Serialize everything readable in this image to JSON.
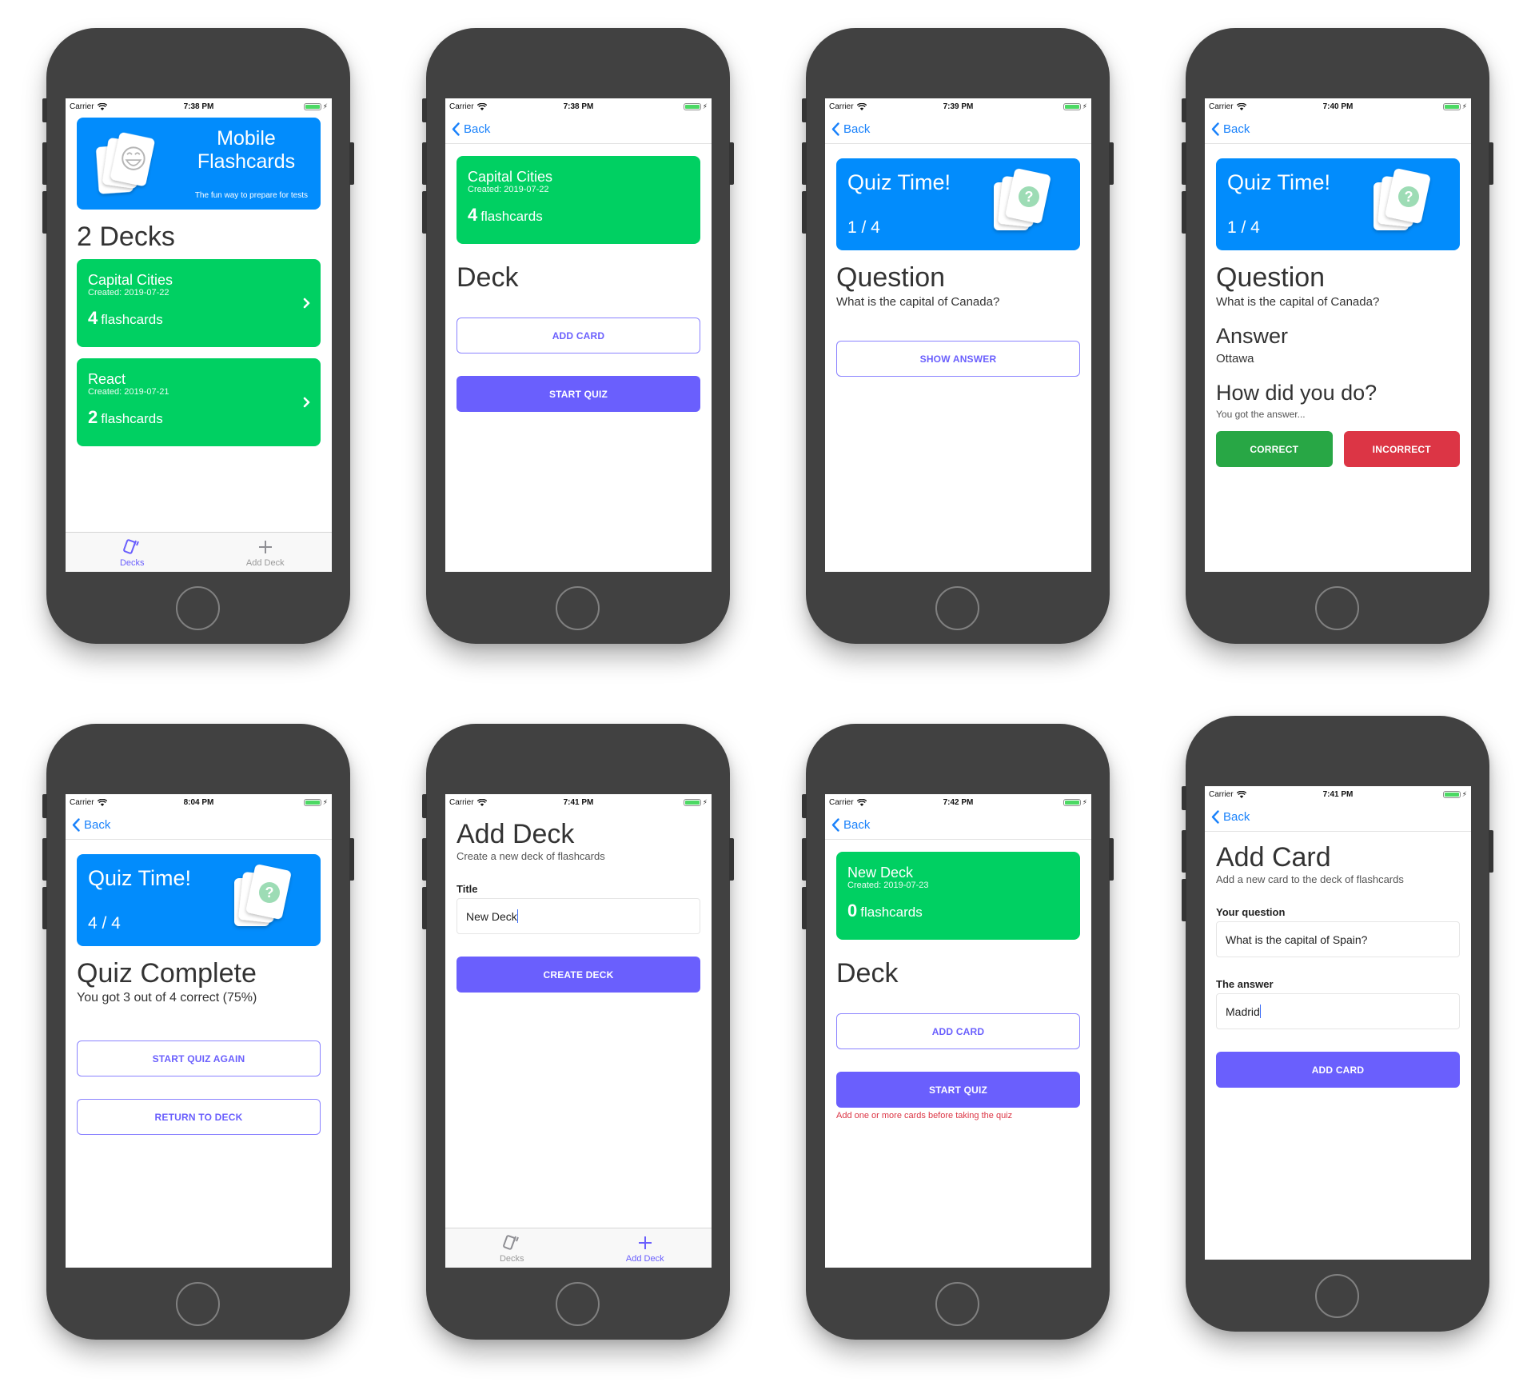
{
  "status_bar": {
    "carrier": "Carrier"
  },
  "colors": {
    "primary_blue": "#028cfc",
    "deck_green": "#00d062",
    "accent_purple": "#6a5ffd",
    "correct_green": "#28a745",
    "incorrect_red": "#dc3545",
    "link_blue": "#1a82fb",
    "error_red": "#dc3545",
    "battery_green": "#4cd964"
  },
  "common": {
    "back_label": "Back",
    "tabs": [
      {
        "label": "Decks",
        "icon": "cards-icon"
      },
      {
        "label": "Add Deck",
        "icon": "plus-icon"
      }
    ]
  },
  "screens": [
    {
      "id": "deck-list",
      "time": "7:38 PM",
      "header": {
        "title_line1": "Mobile",
        "title_line2": "Flashcards",
        "tagline": "The fun way to prepare for tests",
        "icon": "smiley-cards-icon"
      },
      "heading": "2 Decks",
      "decks": [
        {
          "title": "Capital Cities",
          "created": "Created: 2019-07-22",
          "count": "4",
          "count_label": "flashcards"
        },
        {
          "title": "React",
          "created": "Created: 2019-07-21",
          "count": "2",
          "count_label": "flashcards"
        }
      ],
      "active_tab": "Decks"
    },
    {
      "id": "deck-detail",
      "time": "7:38 PM",
      "deck": {
        "title": "Capital Cities",
        "created": "Created: 2019-07-22",
        "count": "4",
        "count_label": "flashcards"
      },
      "heading": "Deck",
      "add_card_label": "ADD CARD",
      "start_quiz_label": "START QUIZ"
    },
    {
      "id": "quiz-question",
      "time": "7:39 PM",
      "quiz_title": "Quiz Time!",
      "progress": "1 / 4",
      "question_heading": "Question",
      "question": "What is the capital of Canada?",
      "show_answer_label": "SHOW ANSWER"
    },
    {
      "id": "quiz-answer",
      "time": "7:40 PM",
      "quiz_title": "Quiz Time!",
      "progress": "1 / 4",
      "question_heading": "Question",
      "question": "What is the capital of Canada?",
      "answer_heading": "Answer",
      "answer": "Ottawa",
      "feedback_heading": "How did you do?",
      "feedback_sub": "You got the answer...",
      "correct_label": "CORRECT",
      "incorrect_label": "INCORRECT"
    },
    {
      "id": "quiz-complete",
      "time": "8:04 PM",
      "quiz_title": "Quiz Time!",
      "progress": "4 / 4",
      "heading": "Quiz Complete",
      "result": "You got 3 out of 4 correct (75%)",
      "score_percent": 75,
      "restart_label": "START QUIZ AGAIN",
      "return_label": "RETURN TO DECK"
    },
    {
      "id": "add-deck",
      "time": "7:41 PM",
      "heading": "Add Deck",
      "subheading": "Create a new deck of flashcards",
      "title_label": "Title",
      "title_value": "New Deck",
      "create_label": "CREATE DECK",
      "active_tab": "Add Deck"
    },
    {
      "id": "new-deck-detail",
      "time": "7:42 PM",
      "deck": {
        "title": "New Deck",
        "created": "Created: 2019-07-23",
        "count": "0",
        "count_label": "flashcards"
      },
      "heading": "Deck",
      "add_card_label": "ADD CARD",
      "start_quiz_label": "START QUIZ",
      "error": "Add one or more cards before taking the quiz"
    },
    {
      "id": "add-card",
      "time": "7:41 PM",
      "heading": "Add Card",
      "subheading": "Add a new card to the deck of flashcards",
      "question_label": "Your question",
      "question_value": "What is the capital of Spain?",
      "answer_label": "The answer",
      "answer_value": "Madrid",
      "submit_label": "ADD CARD"
    }
  ]
}
